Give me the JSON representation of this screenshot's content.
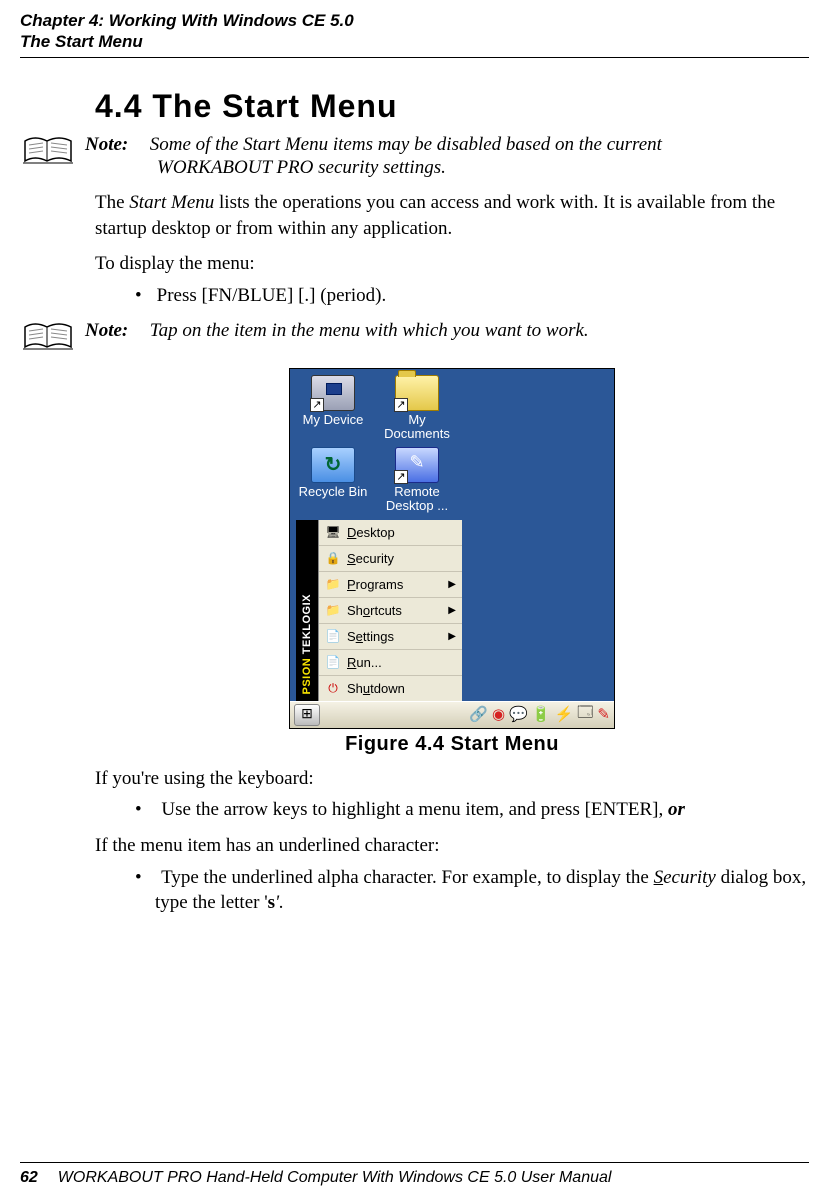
{
  "header": {
    "chapter": "Chapter 4: Working With Windows CE 5.0",
    "section": "The Start Menu"
  },
  "heading": "4.4  The Start Menu",
  "note1": {
    "label": "Note:",
    "text_line1": "Some of the Start Menu items may be disabled based on the current",
    "text_line2": "WORKABOUT PRO security settings."
  },
  "body1": "The Start Menu lists the operations you can access and work with. It is available from the startup desktop or from within any application.",
  "body2": "To display the menu:",
  "bullet1": "Press [FN/BLUE] [.] (period).",
  "note2": {
    "label": "Note:",
    "text": "Tap on the item in the menu with which you want to work."
  },
  "screenshot": {
    "icons": {
      "my_device": "My Device",
      "my_documents_l1": "My",
      "my_documents_l2": "Documents",
      "recycle_bin": "Recycle Bin",
      "remote_l1": "Remote",
      "remote_l2": "Desktop ..."
    },
    "side_brand_y": "PSION",
    "side_brand_w": " TEKLOGIX",
    "menu": {
      "desktop": "Desktop",
      "security": "Security",
      "programs": "Programs",
      "shortcuts": "Shortcuts",
      "settings": "Settings",
      "run": "Run...",
      "shutdown": "Shutdown"
    }
  },
  "figure_caption": "Figure 4.4 Start Menu",
  "body3": "If you're using the keyboard:",
  "bullet2_pre": "Use the arrow keys to highlight a menu item, and press [ENTER], ",
  "bullet2_or": "or",
  "body4": "If the menu item has an underlined character:",
  "bullet3_pre": "Type the underlined alpha character. For example, to display the ",
  "bullet3_s": "S",
  "bullet3_ecurity": "ecurity",
  "bullet3_mid": " dialog box, type the letter '",
  "bullet3_letter": "s",
  "bullet3_end": "'.",
  "footer": {
    "page": "62",
    "title": "WORKABOUT PRO Hand-Held Computer With Windows CE 5.0 User Manual"
  }
}
